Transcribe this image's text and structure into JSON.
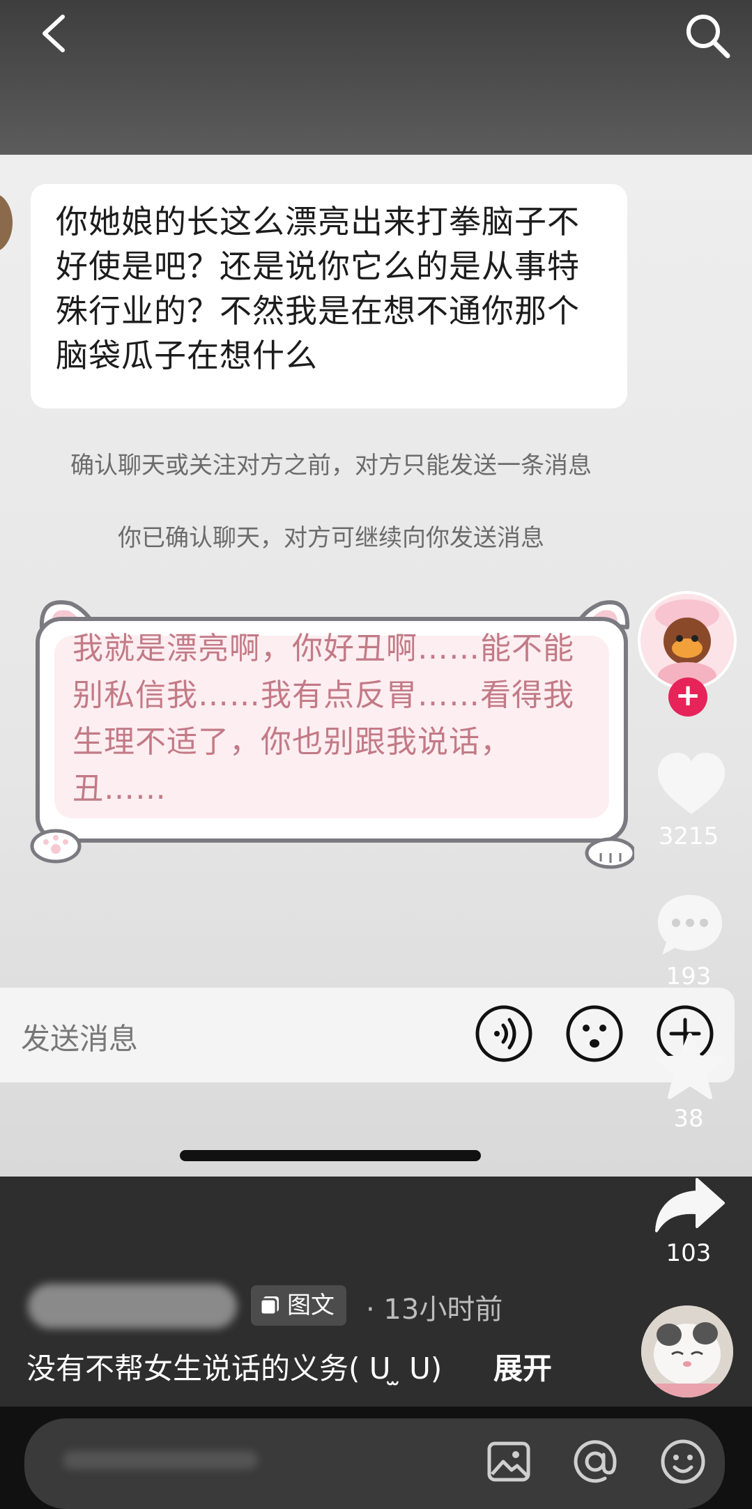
{
  "top_bar": {},
  "chat": {
    "incoming_message": "你她娘的长这么漂亮出来打拳脑子不好使是吧？还是说你它么的是从事特殊行业的？不然我是在想不通你那个脑袋瓜子在想什么",
    "notice_limit": "确认聊天或关注对方之前，对方只能发送一条消息",
    "notice_confirmed": "你已确认聊天，对方可继续向你发送消息",
    "reply_message": "我就是漂亮啊，你好丑啊……能不能别私信我……我有点反胃……看得我生理不适了，你也别跟我说话，丑……",
    "input_placeholder": "发送消息"
  },
  "sidebar": {
    "likes": "3215",
    "comments": "193",
    "favorites": "38",
    "shares": "103"
  },
  "post": {
    "tag": "图文",
    "time": "· 13小时前",
    "caption": "没有不帮女生说话的义务( ᑌ ̫ ᑌ)",
    "expand": "展开"
  },
  "colors": {
    "reply_text": "#c27a86",
    "follow_red": "#e6245a"
  },
  "icons": [
    "back-arrow-icon",
    "search-icon",
    "voice-icon",
    "emoji-icon",
    "plus-icon",
    "heart-icon",
    "comment-icon",
    "star-icon",
    "share-icon",
    "image-icon",
    "at-icon"
  ]
}
